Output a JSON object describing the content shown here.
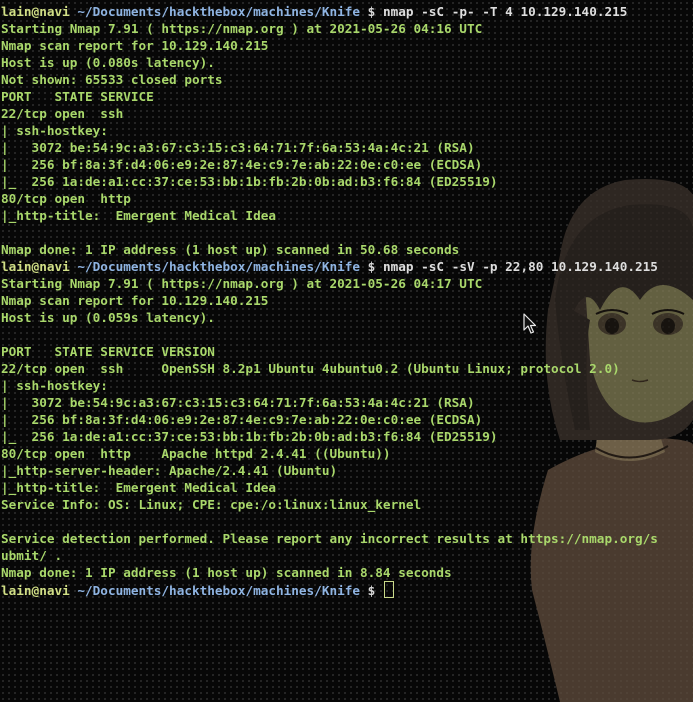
{
  "terminal": {
    "prompt": {
      "user": "lain@navi",
      "cwd": "~/Documents/hackthebox/machines/Knife",
      "symbol": "$"
    },
    "lines": [
      {
        "type": "prompt",
        "cmd": "nmap -sC -p- -T 4 10.129.140.215"
      },
      {
        "type": "out",
        "text": "Starting Nmap 7.91 ( https://nmap.org ) at 2021-05-26 04:16 UTC"
      },
      {
        "type": "out",
        "text": "Nmap scan report for 10.129.140.215"
      },
      {
        "type": "out",
        "text": "Host is up (0.080s latency)."
      },
      {
        "type": "out",
        "text": "Not shown: 65533 closed ports"
      },
      {
        "type": "out",
        "text": "PORT   STATE SERVICE"
      },
      {
        "type": "out",
        "text": "22/tcp open  ssh"
      },
      {
        "type": "out",
        "text": "| ssh-hostkey:"
      },
      {
        "type": "out",
        "text": "|   3072 be:54:9c:a3:67:c3:15:c3:64:71:7f:6a:53:4a:4c:21 (RSA)"
      },
      {
        "type": "out",
        "text": "|   256 bf:8a:3f:d4:06:e9:2e:87:4e:c9:7e:ab:22:0e:c0:ee (ECDSA)"
      },
      {
        "type": "out",
        "text": "|_  256 1a:de:a1:cc:37:ce:53:bb:1b:fb:2b:0b:ad:b3:f6:84 (ED25519)"
      },
      {
        "type": "out",
        "text": "80/tcp open  http"
      },
      {
        "type": "out",
        "text": "|_http-title:  Emergent Medical Idea"
      },
      {
        "type": "out",
        "text": ""
      },
      {
        "type": "out",
        "text": "Nmap done: 1 IP address (1 host up) scanned in 50.68 seconds"
      },
      {
        "type": "prompt",
        "cmd": "nmap -sC -sV -p 22,80 10.129.140.215"
      },
      {
        "type": "out",
        "text": "Starting Nmap 7.91 ( https://nmap.org ) at 2021-05-26 04:17 UTC"
      },
      {
        "type": "out",
        "text": "Nmap scan report for 10.129.140.215"
      },
      {
        "type": "out",
        "text": "Host is up (0.059s latency)."
      },
      {
        "type": "out",
        "text": ""
      },
      {
        "type": "out",
        "text": "PORT   STATE SERVICE VERSION"
      },
      {
        "type": "out",
        "text": "22/tcp open  ssh     OpenSSH 8.2p1 Ubuntu 4ubuntu0.2 (Ubuntu Linux; protocol 2.0)"
      },
      {
        "type": "out",
        "text": "| ssh-hostkey:"
      },
      {
        "type": "out",
        "text": "|   3072 be:54:9c:a3:67:c3:15:c3:64:71:7f:6a:53:4a:4c:21 (RSA)"
      },
      {
        "type": "out",
        "text": "|   256 bf:8a:3f:d4:06:e9:2e:87:4e:c9:7e:ab:22:0e:c0:ee (ECDSA)"
      },
      {
        "type": "out",
        "text": "|_  256 1a:de:a1:cc:37:ce:53:bb:1b:fb:2b:0b:ad:b3:f6:84 (ED25519)"
      },
      {
        "type": "out",
        "text": "80/tcp open  http    Apache httpd 2.4.41 ((Ubuntu))"
      },
      {
        "type": "out",
        "text": "|_http-server-header: Apache/2.4.41 (Ubuntu)"
      },
      {
        "type": "out",
        "text": "|_http-title:  Emergent Medical Idea"
      },
      {
        "type": "out",
        "text": "Service Info: OS: Linux; CPE: cpe:/o:linux:linux_kernel"
      },
      {
        "type": "out",
        "text": ""
      },
      {
        "type": "out",
        "text": "Service detection performed. Please report any incorrect results at https://nmap.org/s"
      },
      {
        "type": "out",
        "text": "ubmit/ ."
      },
      {
        "type": "out",
        "text": "Nmap done: 1 IP address (1 host up) scanned in 8.84 seconds"
      },
      {
        "type": "prompt",
        "cmd": "",
        "cursor": true
      }
    ]
  },
  "colors": {
    "output": "#a9d86b",
    "user": "#d1df86",
    "path": "#8fb4e2",
    "background": "#070707"
  },
  "icons": [
    "mouse-pointer-icon",
    "text-cursor-icon"
  ]
}
